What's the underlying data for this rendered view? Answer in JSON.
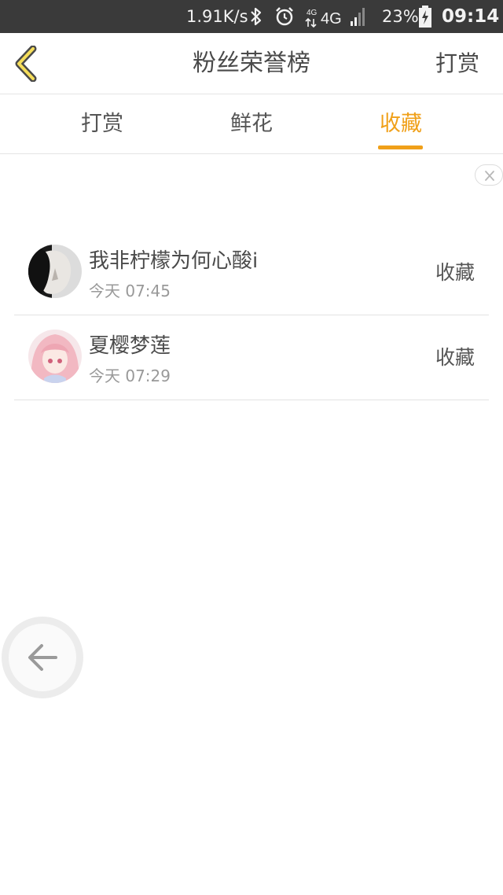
{
  "status_bar": {
    "net_speed": "1.91K/s",
    "network": "4G",
    "battery": "23%",
    "time": "09:14"
  },
  "header": {
    "title": "粉丝荣誉榜",
    "right_action": "打赏"
  },
  "tabs": [
    {
      "label": "打赏",
      "active": false
    },
    {
      "label": "鲜花",
      "active": false
    },
    {
      "label": "收藏",
      "active": true
    }
  ],
  "accent_color": "#f0a019",
  "list": [
    {
      "name": "我非柠檬为何心酸i",
      "time": "今天 07:45",
      "action": "收藏"
    },
    {
      "name": "夏樱梦莲",
      "time": "今天 07:29",
      "action": "收藏"
    }
  ]
}
